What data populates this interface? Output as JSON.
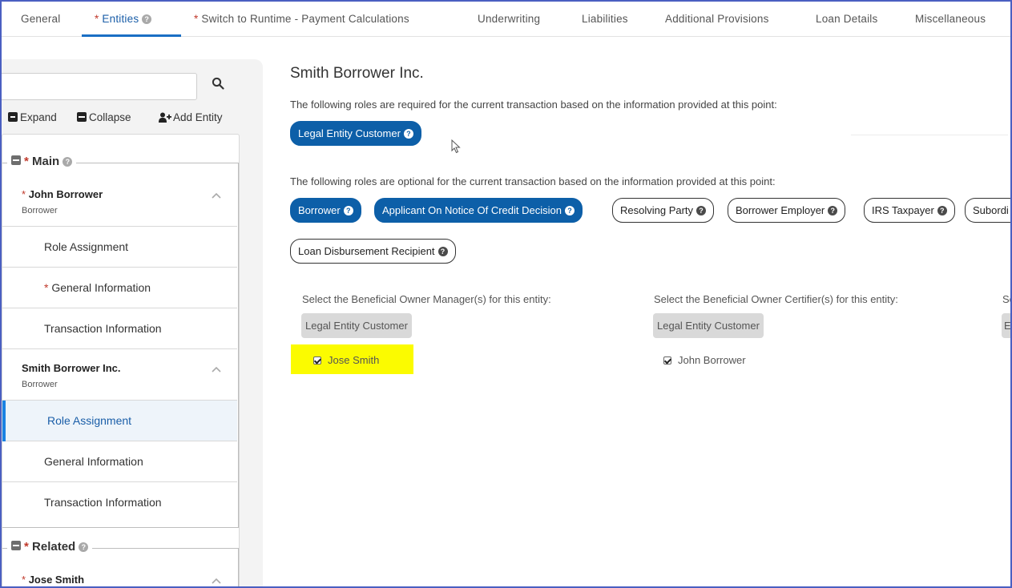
{
  "tabs": [
    {
      "label": "General",
      "required": false,
      "has_help": false
    },
    {
      "label": "Entities",
      "required": true,
      "has_help": true,
      "active": true
    },
    {
      "label": "Switch to Runtime - Payment Calculations",
      "required": true,
      "has_help": false
    },
    {
      "label": "Underwriting",
      "required": false,
      "has_help": false
    },
    {
      "label": "Liabilities",
      "required": false,
      "has_help": false
    },
    {
      "label": "Additional Provisions",
      "required": false,
      "has_help": false
    },
    {
      "label": "Loan Details",
      "required": false,
      "has_help": false
    },
    {
      "label": "Miscellaneous",
      "required": false,
      "has_help": false
    }
  ],
  "required_marker": "*",
  "help_glyph": "?",
  "sidebar": {
    "search": {
      "value": "",
      "placeholder": ""
    },
    "actions": {
      "expand": "Expand",
      "collapse": "Collapse",
      "add_entity": "Add Entity"
    },
    "groups": {
      "main": {
        "label": "Main"
      },
      "related": {
        "label": "Related"
      }
    },
    "entities": [
      {
        "name": "John Borrower",
        "required": true,
        "role": "Borrower"
      },
      {
        "name": "Smith Borrower Inc.",
        "required": false,
        "role": "Borrower"
      },
      {
        "name": "Jose Smith",
        "required": true
      }
    ],
    "sub_items": {
      "role_assignment": "Role Assignment",
      "general_information": "General Information",
      "transaction_information": "Transaction Information"
    }
  },
  "main": {
    "title": "Smith Borrower Inc.",
    "required_text": "The following roles are required for the current transaction based on the information provided at this point:",
    "optional_text": "The following roles are optional for the current transaction based on the information provided at this point:",
    "required_roles": [
      "Legal Entity Customer"
    ],
    "optional_roles": [
      {
        "label": "Borrower",
        "selected": true
      },
      {
        "label": "Applicant On Notice Of Credit Decision",
        "selected": true
      },
      {
        "label": "Resolving Party",
        "selected": false
      },
      {
        "label": "Borrower Employer",
        "selected": false
      },
      {
        "label": "IRS Taxpayer",
        "selected": false
      },
      {
        "label": "Subordi",
        "selected": false
      },
      {
        "label": "Loan Disbursement Recipient",
        "selected": false
      }
    ],
    "beneficial_owner": {
      "manager_label": "Select the Beneficial Owner Manager(s) for this entity:",
      "certifier_label": "Select the Beneficial Owner Certifier(s) for this entity:",
      "third_label_fragment": "Se",
      "chip": "Legal Entity Customer",
      "third_chip_fragment": "E",
      "manager_person": "Jose Smith",
      "certifier_person": "John Borrower"
    }
  },
  "colors": {
    "accent": "#0d5fa8",
    "tab_active": "#1a5ea8",
    "required": "#c0392b",
    "highlight": "#fbfb00",
    "frame": "#4a5fc1"
  }
}
